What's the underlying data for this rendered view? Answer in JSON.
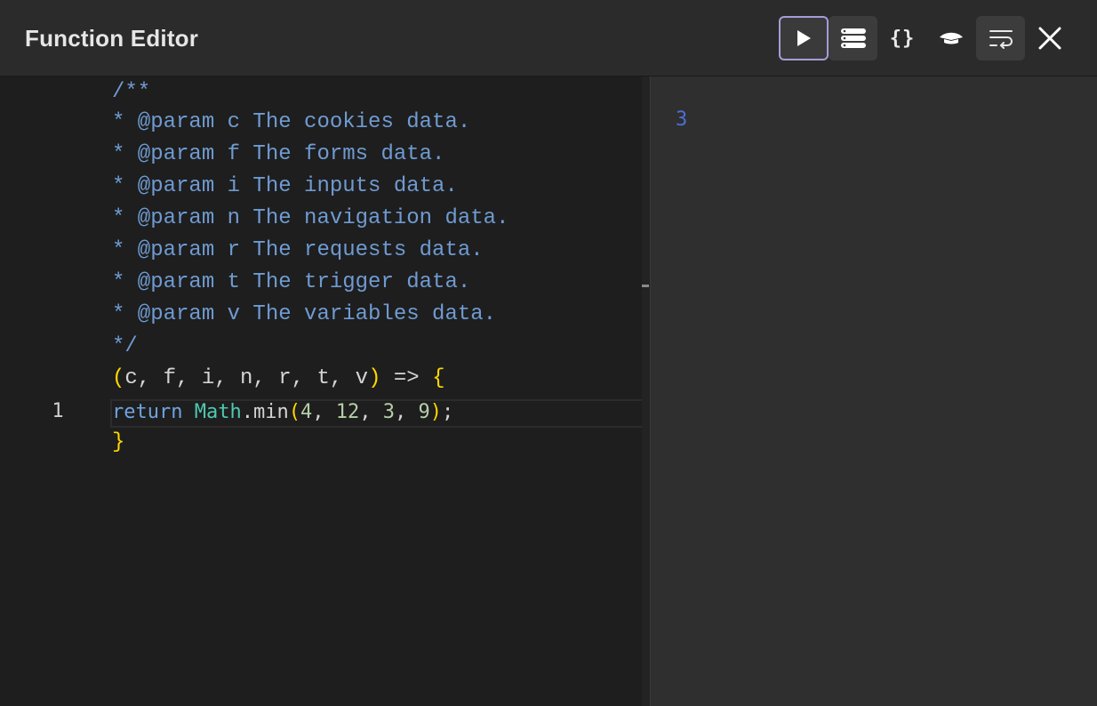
{
  "header": {
    "title": "Function Editor",
    "toolbar": {
      "run": "play-icon",
      "list": "list-icon",
      "braces_label": "{}",
      "hat": "graduation-cap-icon",
      "wrap": "word-wrap-icon",
      "close": "close-icon"
    }
  },
  "editor": {
    "doc_lines": [
      "/**",
      "* @param c The cookies data.",
      "* @param f The forms data.",
      "* @param i The inputs data.",
      "* @param n The navigation data.",
      "* @param r The requests data.",
      "* @param t The trigger data.",
      "* @param v The variables data.",
      "*/"
    ],
    "signature": {
      "open_paren": "(",
      "params": "c, f, i, n, r, t, v",
      "close_paren": ")",
      "arrow": " => ",
      "open_brace": "{"
    },
    "line_number": "1",
    "code": {
      "keyword": "return",
      "object": "Math",
      "dot_method": ".min",
      "open_paren": "(",
      "args": [
        "4",
        "12",
        "3",
        "9"
      ],
      "close_paren": ")",
      "semicolon": ";"
    },
    "close_brace": "}"
  },
  "output": {
    "value": "3"
  },
  "colors": {
    "accent_border": "#a79bd8",
    "comment": "#6f9bd2",
    "keyword": "#6fa3e0",
    "class": "#4ec9b0",
    "number": "#b5cea8",
    "bracket": "#ffd700",
    "output_value": "#4a6fd8"
  }
}
